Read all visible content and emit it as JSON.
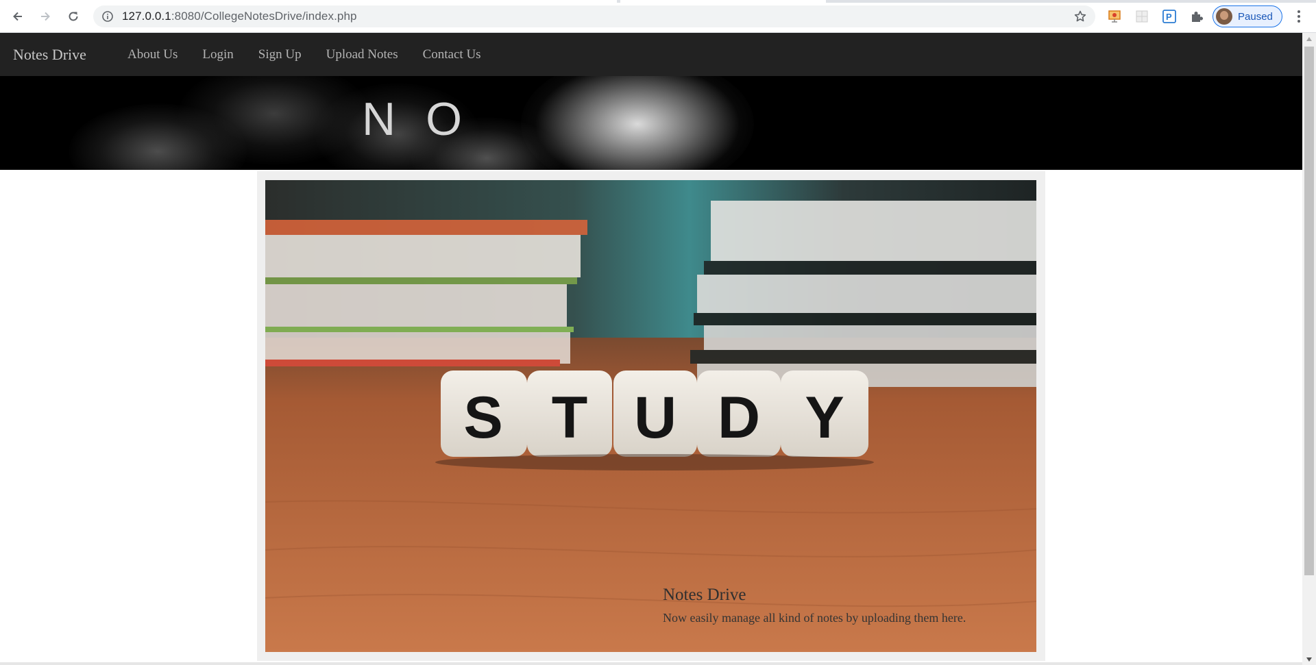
{
  "browser": {
    "url_host": "127.0.0.1",
    "url_rest": ":8080/CollegeNotesDrive/index.php",
    "profile_label": "Paused",
    "icons": [
      "back-icon",
      "forward-icon",
      "reload-icon",
      "info-icon",
      "star-icon",
      "extension-icons",
      "puzzle-icon",
      "menu-icon"
    ]
  },
  "nav": {
    "brand": "Notes Drive",
    "links": [
      "About Us",
      "Login",
      "Sign Up",
      "Upload Notes",
      "Contact Us"
    ]
  },
  "banner": {
    "text": "NO"
  },
  "carousel": {
    "dice_letters": [
      "S",
      "T",
      "U",
      "D",
      "Y"
    ],
    "caption_title": "Notes Drive",
    "caption_text": "Now easily manage all kind of notes by uploading them here."
  },
  "colors": {
    "nav_bg": "#222222",
    "banner_bg": "#000000",
    "accent_profile": "#1a73e8"
  }
}
